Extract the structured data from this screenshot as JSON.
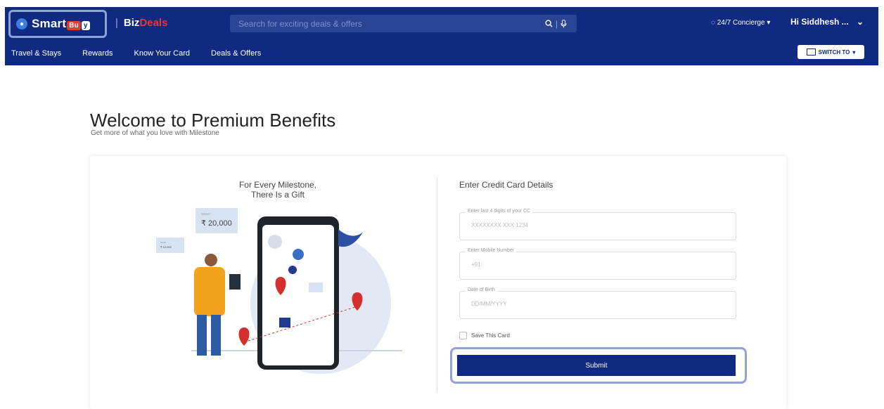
{
  "header": {
    "logo": {
      "prefix": "Smart",
      "badge1": "Bu",
      "badge2": "y"
    },
    "bizdeals": {
      "biz": "Biz",
      "deals": "Deals"
    },
    "search": {
      "placeholder": "Search for exciting deals & offers",
      "icons": [
        "search-icon",
        "mic-icon"
      ]
    },
    "concierge": "24/7 Concierge",
    "greeting": "Hi Siddhesh ...",
    "switch_label": "SWITCH TO"
  },
  "nav": {
    "items": [
      "Travel & Stays",
      "Rewards",
      "Know Your Card",
      "Deals & Offers"
    ]
  },
  "main": {
    "title": "Welcome to Premium Benefits",
    "subtitle": "Get more of what you love with Milestone",
    "promo": {
      "line1": "For Every Milestone,",
      "line2": "There Is a Gift",
      "spend_label": "SPENT",
      "spend_value": "₹ 20,000",
      "save_label": "SAVE",
      "save_value": "₹ 10,000"
    },
    "form": {
      "title": "Enter Credit Card Details",
      "fields": [
        {
          "label": "Enter last 4 digits of your CC",
          "placeholder": "XXXXXXXX XXX 1234"
        },
        {
          "label": "Enter Mobile Number",
          "placeholder": "+91"
        },
        {
          "label": "Date of Birth",
          "placeholder": "DD/MM/YYYY"
        }
      ],
      "save_card_label": "Save This Card",
      "submit_label": "Submit"
    }
  },
  "colors": {
    "brand": "#0f2a80",
    "accent": "#e53935",
    "highlight": "#8fa3d6"
  }
}
